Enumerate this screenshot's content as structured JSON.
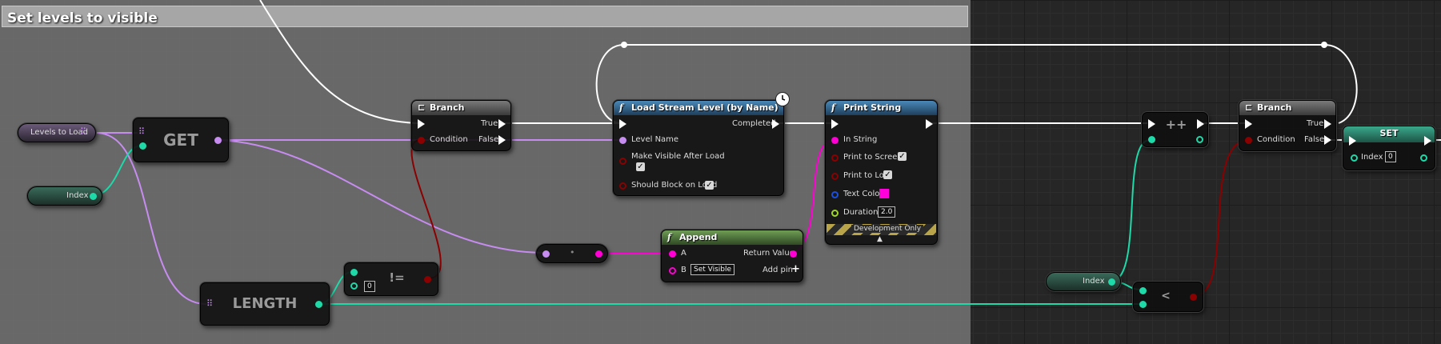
{
  "comment": {
    "title": "Set levels to visible"
  },
  "nodes": {
    "levels_to_load": {
      "label": "Levels to Load"
    },
    "index_a": {
      "label": "Index"
    },
    "get": {
      "label": "GET"
    },
    "length": {
      "label": "LENGTH"
    },
    "not_equal": {
      "op": "!=",
      "value": "0"
    },
    "branch1": {
      "title": "Branch",
      "true": "True",
      "false": "False",
      "condition": "Condition"
    },
    "load_stream": {
      "title": "Load Stream Level (by Name)",
      "completed": "Completed",
      "level_name": "Level Name",
      "make_visible": "Make Visible After Load",
      "block": "Should Block on Load"
    },
    "print_string": {
      "title": "Print String",
      "in_string": "In String",
      "to_screen": "Print to Screen",
      "to_log": "Print to Log",
      "text_color": "Text Color",
      "duration": "Duration",
      "duration_value": "2.0",
      "dev_only": "Development Only"
    },
    "append": {
      "title": "Append",
      "a": "A",
      "b": "B",
      "b_value": "Set Visible",
      "return_value": "Return Value",
      "add_pin": "Add pin"
    },
    "increment": {
      "op": "++"
    },
    "index_b": {
      "label": "Index"
    },
    "less_than": {
      "op": "<"
    },
    "branch2": {
      "title": "Branch",
      "true": "True",
      "false": "False",
      "condition": "Condition"
    },
    "set": {
      "title": "SET",
      "index": "Index",
      "index_value": "0"
    }
  },
  "colors": {
    "exec": "#ffffff",
    "string": "#ff00d4",
    "bool": "#8b0000",
    "int": "#1ed9a8",
    "array": "#c78cf0",
    "text_color_swatch": "#ff00dc"
  },
  "icons": {
    "branch": "branch-icon",
    "function": "function-icon",
    "clock": "clock-icon",
    "add": "plus-icon",
    "array": "array-grid-icon"
  }
}
